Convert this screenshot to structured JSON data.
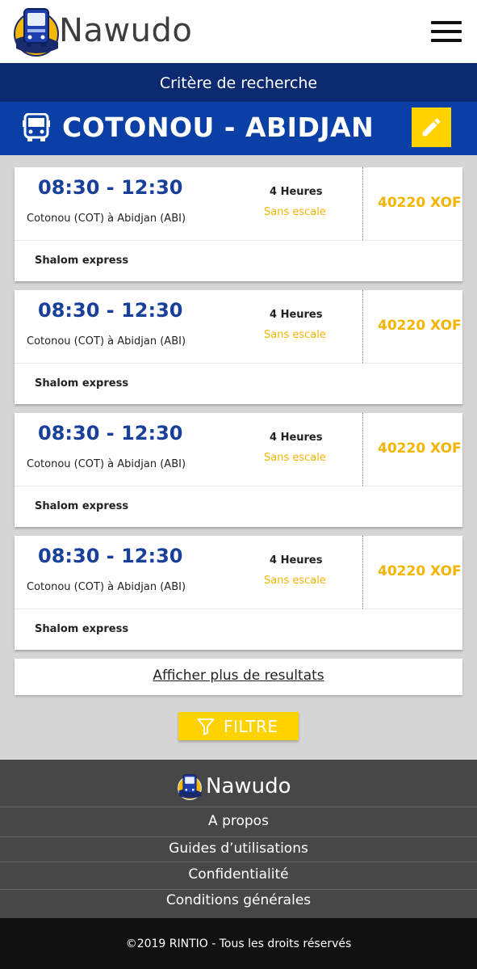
{
  "header": {
    "brand": "Nawudo",
    "menu_icon": "hamburger-menu-icon"
  },
  "search": {
    "criteria_label": "Critère de recherche",
    "route": "COTONOU - ABIDJAN",
    "route_icon": "bus-icon",
    "edit_icon": "pencil-icon"
  },
  "results": [
    {
      "time": "08:30 - 12:30",
      "route": "Cotonou (COT) à Abidjan (ABI)",
      "duration": "4 Heures",
      "stops": "Sans escale",
      "price": "40220 XOF",
      "company": "Shalom express"
    },
    {
      "time": "08:30 - 12:30",
      "route": "Cotonou (COT) à Abidjan (ABI)",
      "duration": "4 Heures",
      "stops": "Sans escale",
      "price": "40220 XOF",
      "company": "Shalom express"
    },
    {
      "time": "08:30 - 12:30",
      "route": "Cotonou (COT) à Abidjan (ABI)",
      "duration": "4 Heures",
      "stops": "Sans escale",
      "price": "40220 XOF",
      "company": "Shalom express"
    },
    {
      "time": "08:30 - 12:30",
      "route": "Cotonou (COT) à Abidjan (ABI)",
      "duration": "4 Heures",
      "stops": "Sans escale",
      "price": "40220 XOF",
      "company": "Shalom express"
    }
  ],
  "more_results": "Afficher plus de resultats",
  "filter": {
    "label": "FILTRE",
    "icon": "filter-icon"
  },
  "footer": {
    "brand": "Nawudo",
    "links": [
      "A propos",
      "Guides d’utilisations",
      "Confidentialité",
      "Conditions générales"
    ],
    "copyright": "©2019 RINTIO - Tous les droits réservés"
  },
  "colors": {
    "navy": "#0b2a6f",
    "blue": "#0a3fa6",
    "accent_yellow": "#ffd200",
    "price_yellow": "#f4b400",
    "footer_gray": "#474747"
  }
}
